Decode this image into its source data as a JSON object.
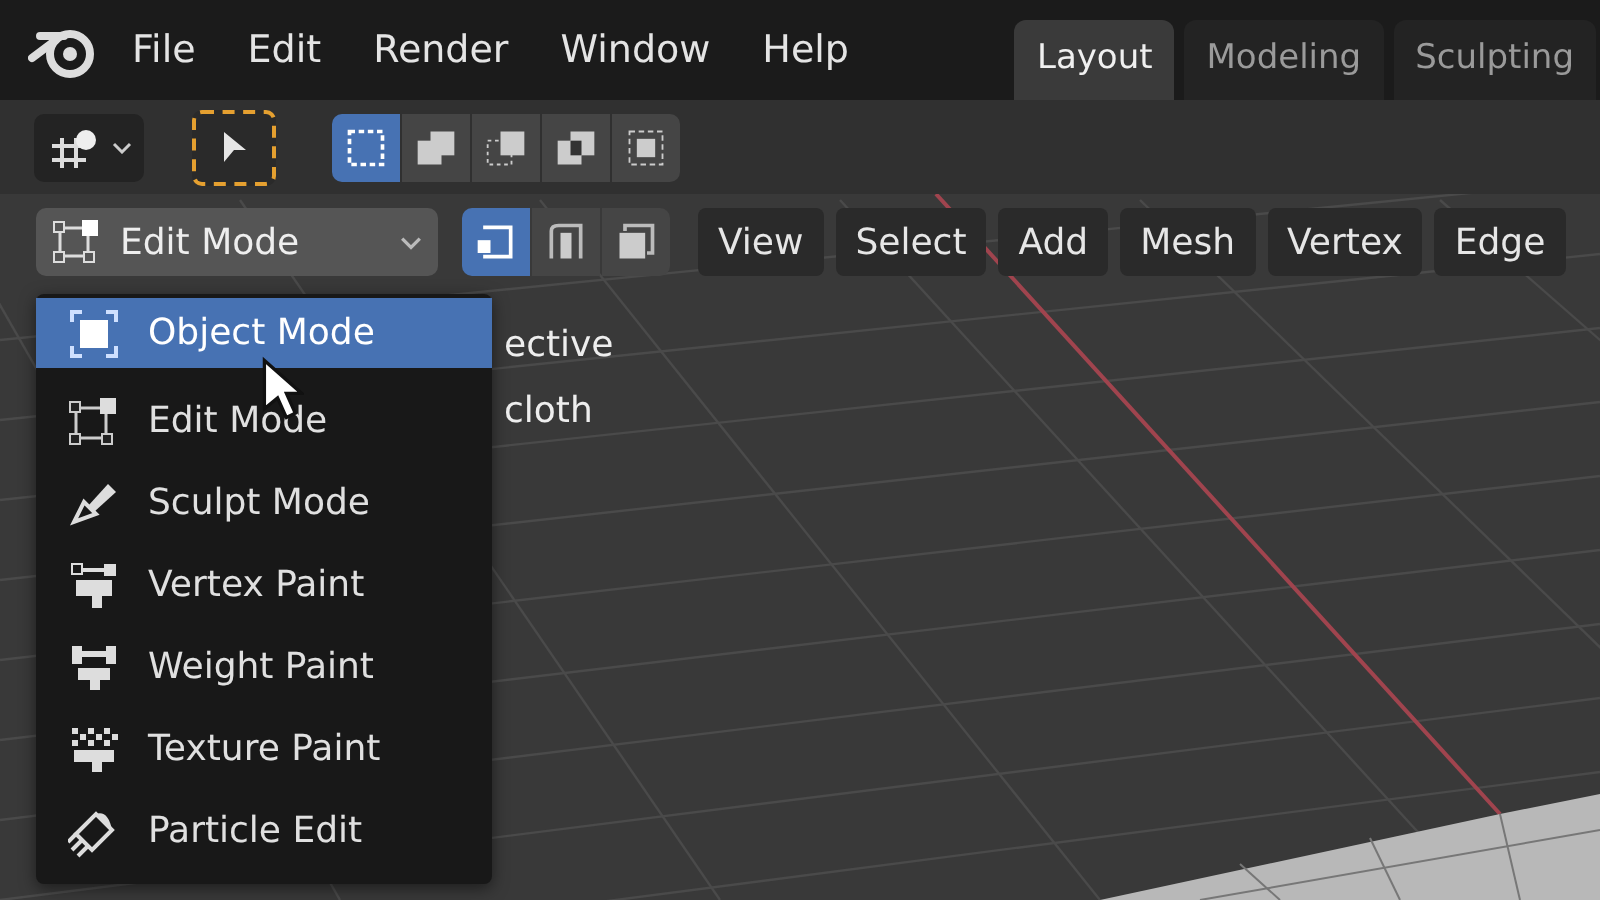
{
  "menubar": {
    "items": [
      "File",
      "Edit",
      "Render",
      "Window",
      "Help"
    ]
  },
  "workspace_tabs": [
    {
      "label": "Layout",
      "selected": true
    },
    {
      "label": "Modeling",
      "selected": false
    },
    {
      "label": "Sculpting",
      "selected": false
    }
  ],
  "tool_header": {
    "select_box_modes": [
      {
        "selected": true
      },
      {
        "selected": false
      },
      {
        "selected": false
      },
      {
        "selected": false
      },
      {
        "selected": false
      }
    ]
  },
  "viewport_header": {
    "mode_dropdown": "Edit Mode",
    "mesh_select_modes": [
      {
        "selected": true
      },
      {
        "selected": false
      },
      {
        "selected": false
      }
    ],
    "menus": [
      "View",
      "Select",
      "Add",
      "Mesh",
      "Vertex",
      "Edge"
    ]
  },
  "viewport_overlay_texts": [
    "ective",
    "cloth"
  ],
  "mode_menu": {
    "items": [
      {
        "label": "Object Mode",
        "kind": "object",
        "selected": true
      },
      {
        "label": "Edit Mode",
        "kind": "edit",
        "selected": false
      },
      {
        "label": "Sculpt Mode",
        "kind": "sculpt",
        "selected": false
      },
      {
        "label": "Vertex Paint",
        "kind": "vertex_paint",
        "selected": false
      },
      {
        "label": "Weight Paint",
        "kind": "weight_paint",
        "selected": false
      },
      {
        "label": "Texture Paint",
        "kind": "texture_paint",
        "selected": false
      },
      {
        "label": "Particle Edit",
        "kind": "particle",
        "selected": false
      }
    ]
  }
}
